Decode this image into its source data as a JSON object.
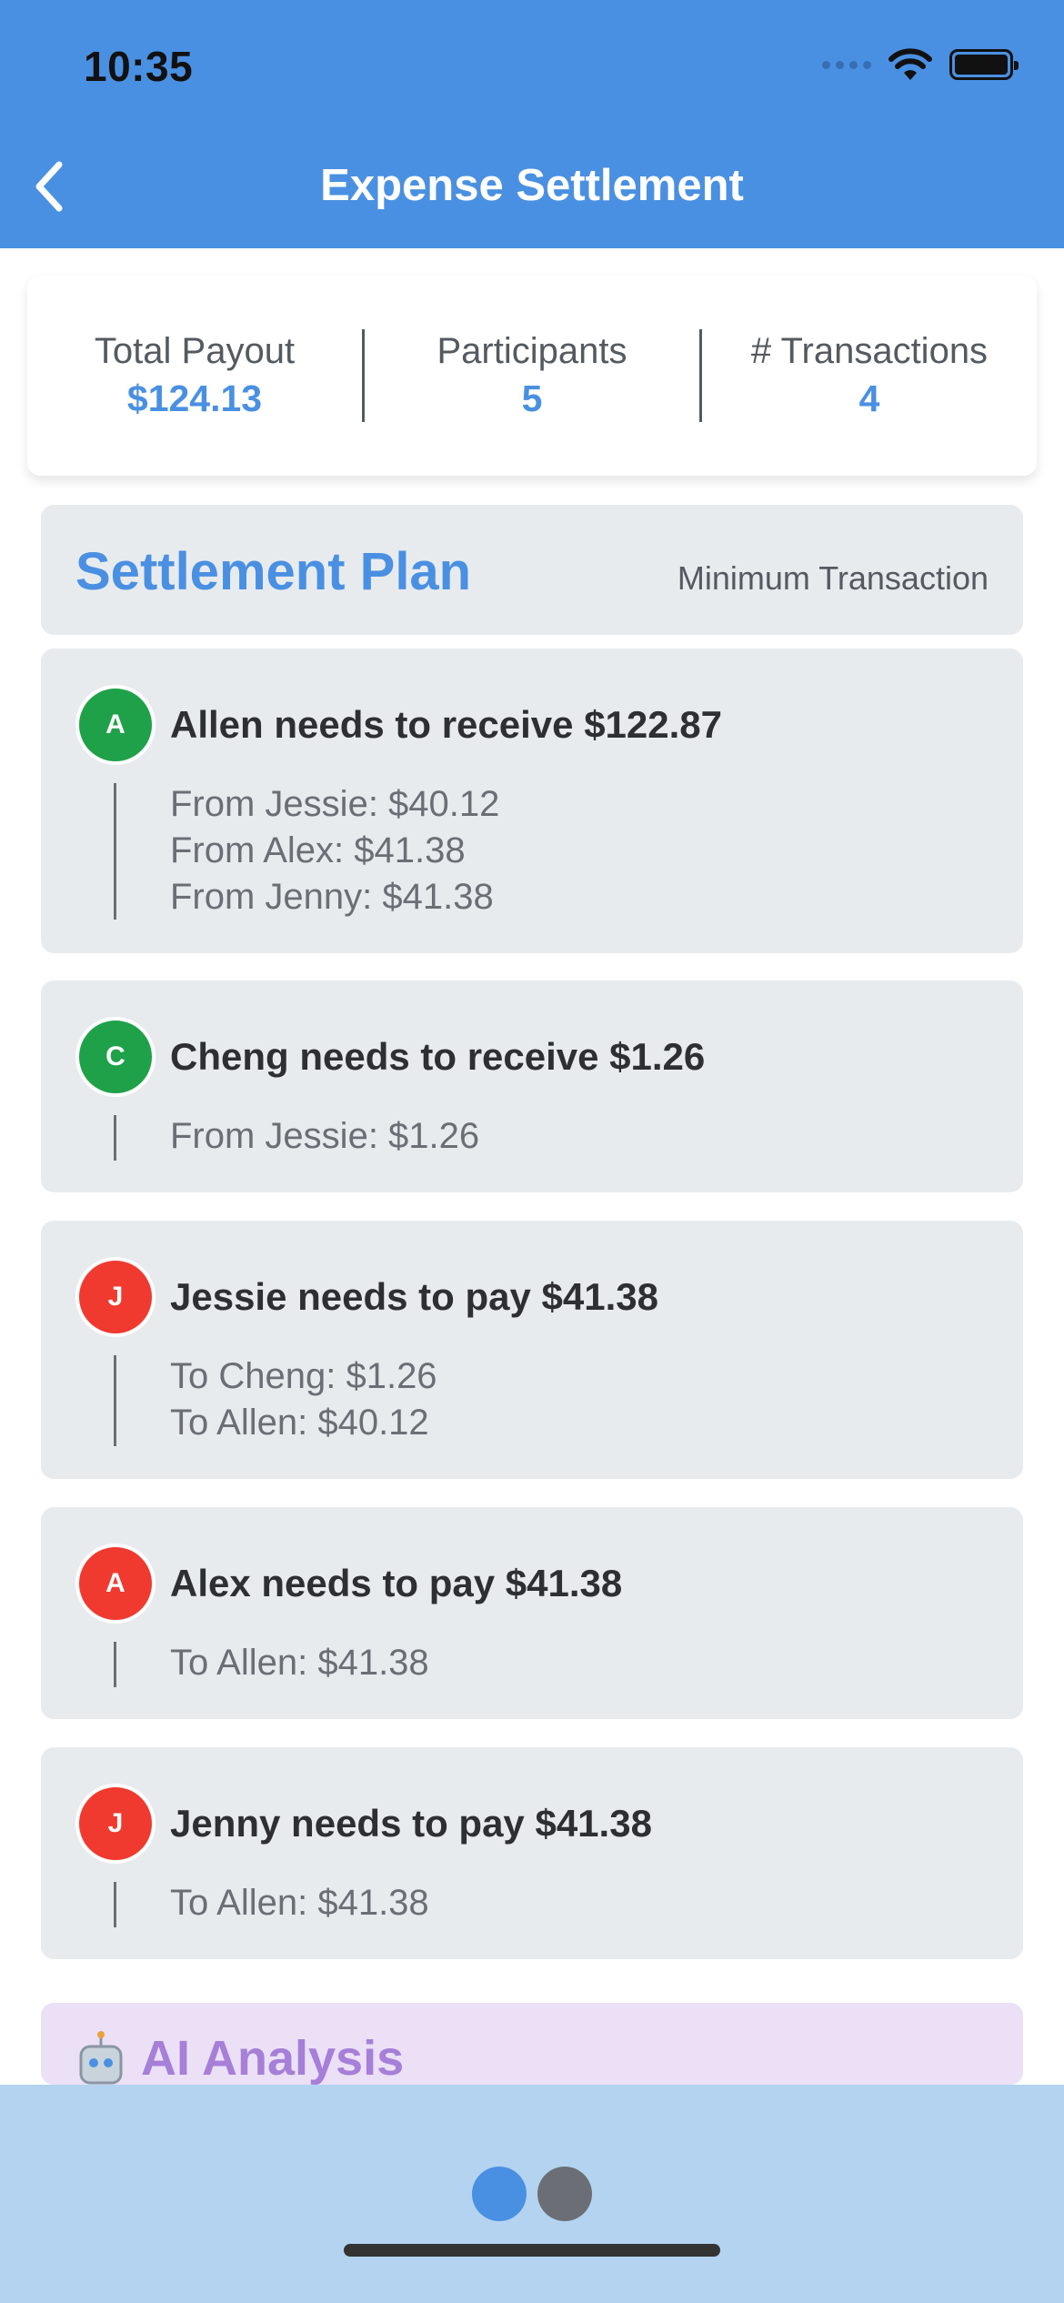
{
  "status_bar": {
    "time": "10:35"
  },
  "nav": {
    "title": "Expense Settlement",
    "back_icon": "chevron-left-icon"
  },
  "summary": [
    {
      "label": "Total Payout",
      "value": "$124.13"
    },
    {
      "label": "Participants",
      "value": "5"
    },
    {
      "label": "# Transactions",
      "value": "4"
    }
  ],
  "plan": {
    "title": "Settlement Plan",
    "mode": "Minimum Transaction"
  },
  "entries": [
    {
      "initial": "A",
      "type": "receive",
      "title": "Allen needs to receive $122.87",
      "details": [
        "From Jessie: $40.12",
        "From Alex: $41.38",
        "From Jenny: $41.38"
      ]
    },
    {
      "initial": "C",
      "type": "receive",
      "title": "Cheng needs to receive $1.26",
      "details": [
        "From Jessie: $1.26"
      ]
    },
    {
      "initial": "J",
      "type": "pay",
      "title": "Jessie needs to pay $41.38",
      "details": [
        "To Cheng: $1.26",
        "To Allen: $40.12"
      ]
    },
    {
      "initial": "A",
      "type": "pay",
      "title": "Alex needs to pay $41.38",
      "details": [
        "To Allen: $41.38"
      ]
    },
    {
      "initial": "J",
      "type": "pay",
      "title": "Jenny needs to pay $41.38",
      "details": [
        "To Allen: $41.38"
      ]
    }
  ],
  "ai_analysis": {
    "title": "AI Analysis",
    "icon": "robot-icon"
  },
  "colors": {
    "primary": "#4a90e2",
    "receive": "#1fa14a",
    "pay": "#f03a30",
    "ai": "#a67fd8"
  }
}
